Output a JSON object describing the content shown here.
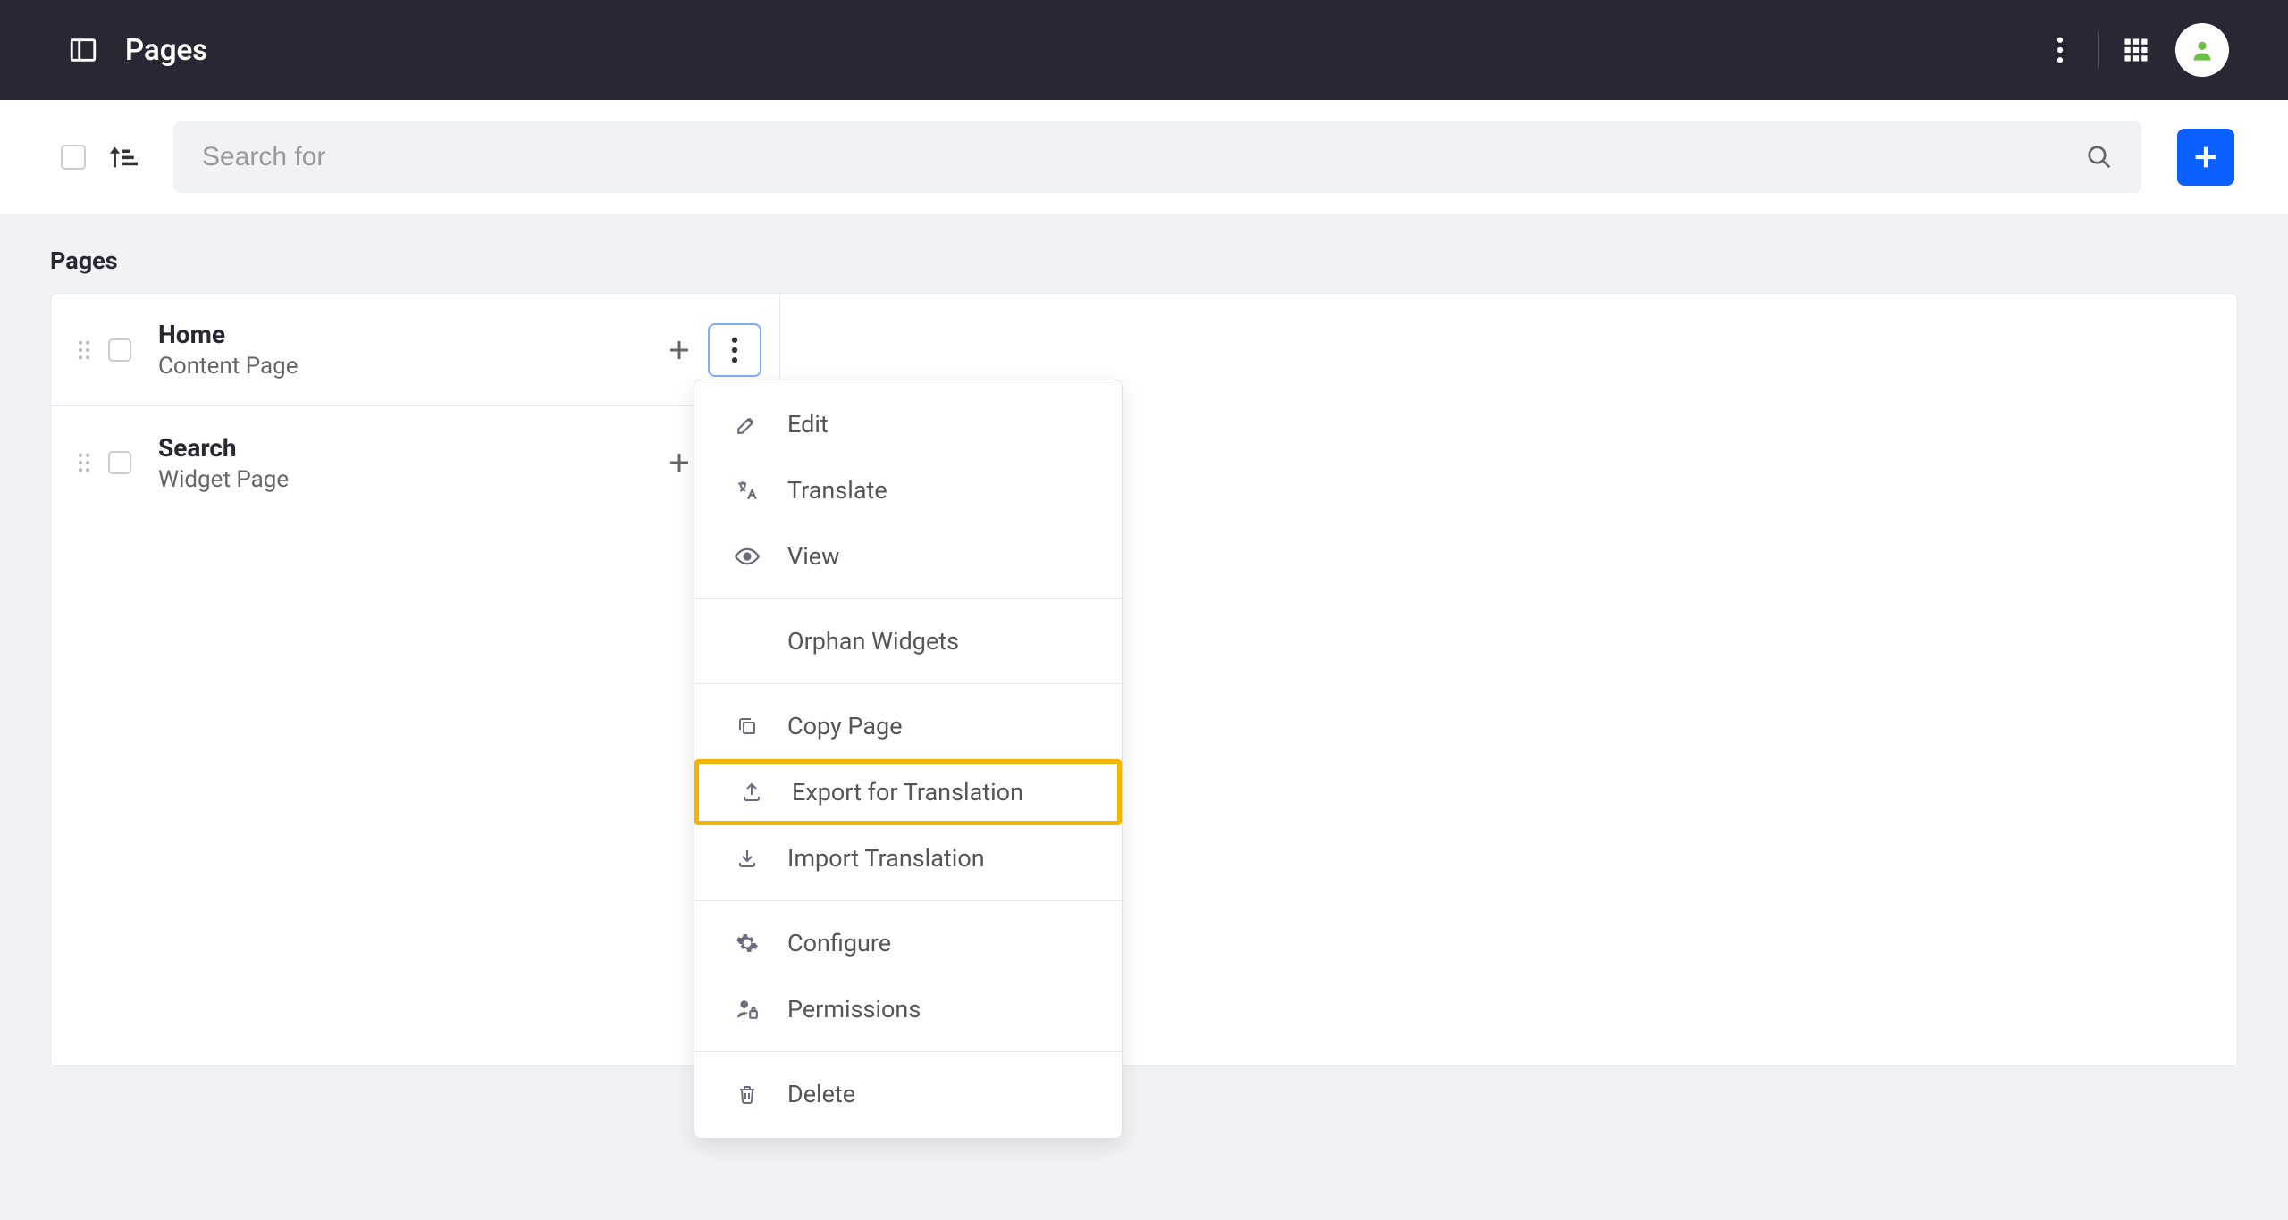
{
  "header": {
    "title": "Pages"
  },
  "toolbar": {
    "search_placeholder": "Search for"
  },
  "section_label": "Pages",
  "pages": [
    {
      "title": "Home",
      "subtitle": "Content Page"
    },
    {
      "title": "Search",
      "subtitle": "Widget Page"
    }
  ],
  "menu": {
    "edit": "Edit",
    "translate": "Translate",
    "view": "View",
    "orphan": "Orphan Widgets",
    "copy": "Copy Page",
    "export": "Export for Translation",
    "import": "Import Translation",
    "configure": "Configure",
    "permissions": "Permissions",
    "delete": "Delete"
  }
}
